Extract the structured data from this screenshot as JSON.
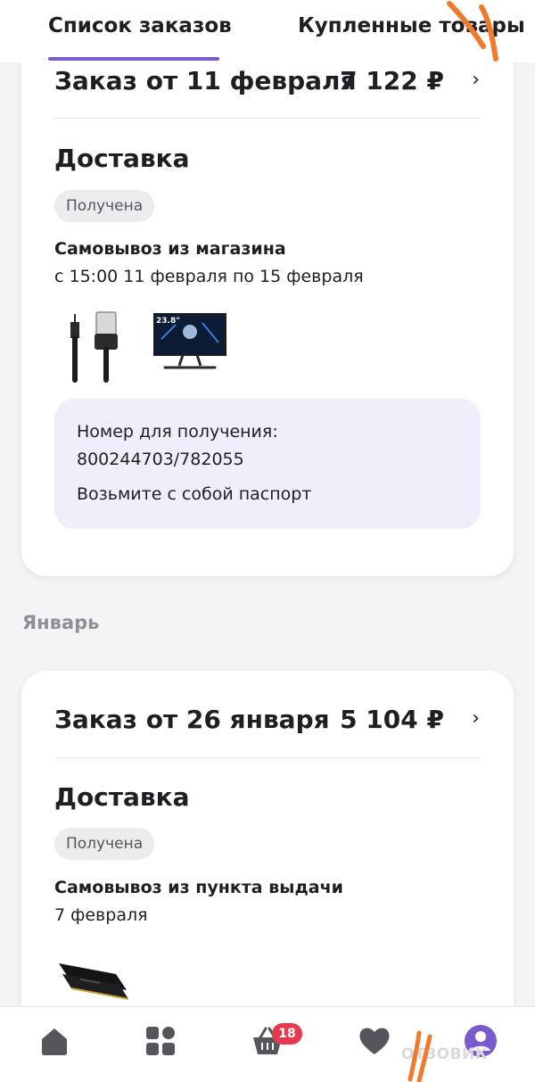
{
  "tabs": [
    {
      "label": "Список заказов",
      "active": true
    },
    {
      "label": "Купленные товары",
      "active": false
    }
  ],
  "orders": [
    {
      "title": "Заказ от 11 февраля",
      "price": "7 122 ₽",
      "delivery_title": "Доставка",
      "status": "Получена",
      "pickup_type": "Самовывоз из магазина",
      "pickup_date": "с 15:00 11 февраля по 15 февраля",
      "products": [
        "usb-cable",
        "monitor"
      ],
      "monitor_label": "23.8\"",
      "pickup_info": {
        "label": "Номер для получения:",
        "number": "800244703/782055",
        "note": "Возьмите с собой паспорт"
      }
    },
    {
      "title": "Заказ от 26 января",
      "price": "5 104 ₽",
      "delivery_title": "Доставка",
      "status": "Получена",
      "pickup_type": "Самовывоз из пункта выдачи",
      "pickup_date": "7 февраля",
      "products": [
        "ram-module"
      ]
    }
  ],
  "month_label": "Январь",
  "bottom_nav": {
    "items": [
      "home-icon",
      "catalog-icon",
      "cart-icon",
      "heart-icon",
      "profile-icon"
    ],
    "cart_count": "18"
  },
  "watermark": "ОТЗОВИК",
  "colors": {
    "accent": "#7a5bcf",
    "badge_red": "#e5394f",
    "info_bg": "#f1edfb",
    "nav_icon": "#55555c",
    "scribble": "#f07a2c"
  }
}
